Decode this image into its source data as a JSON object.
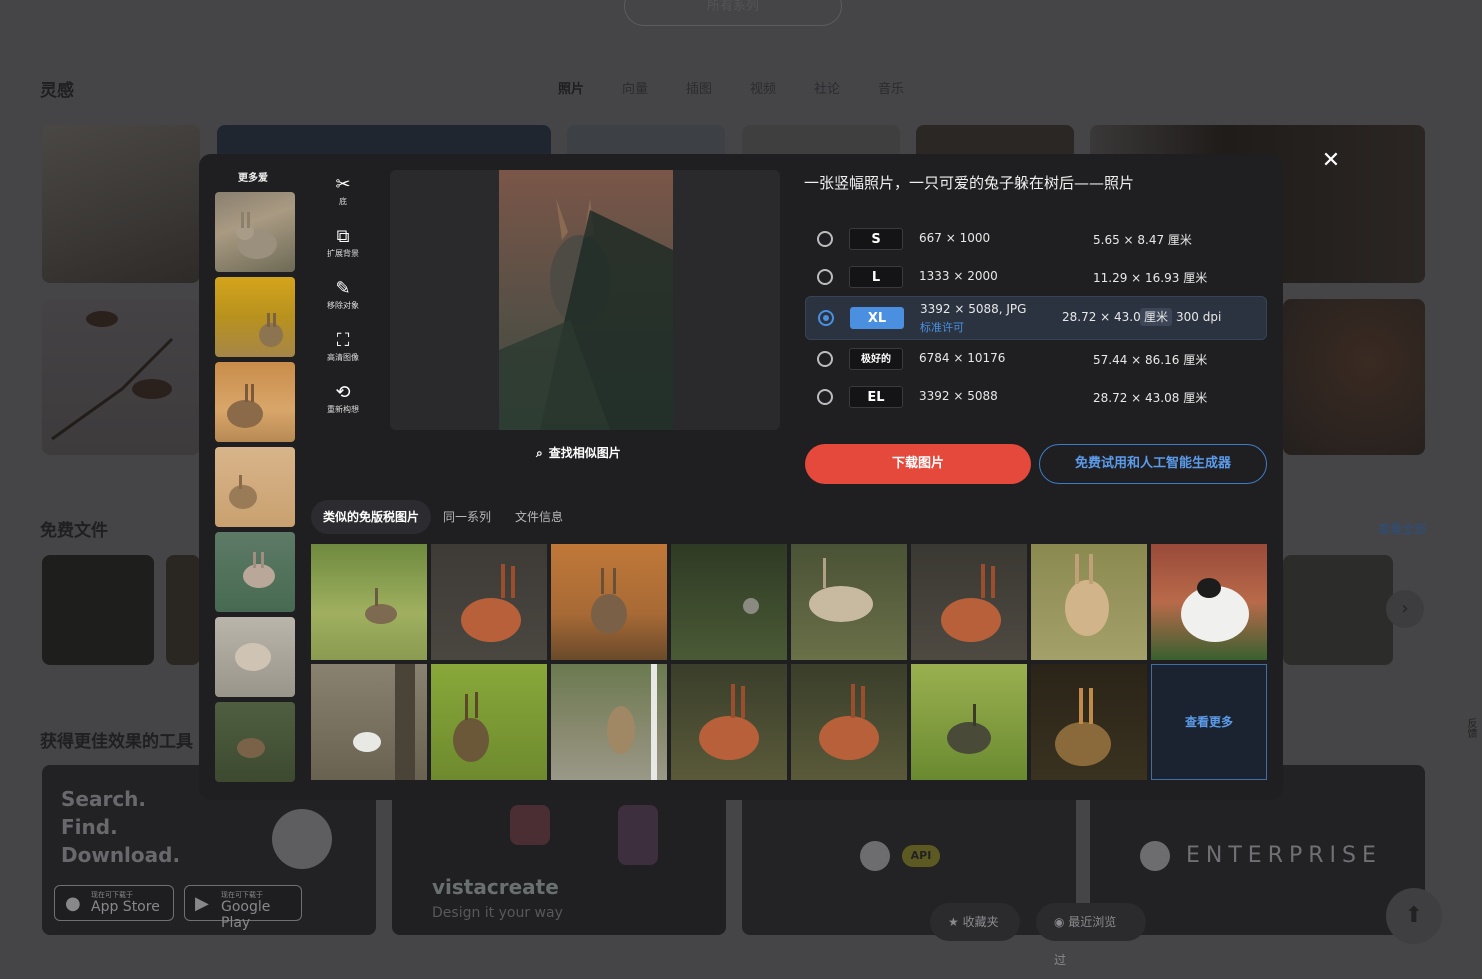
{
  "background": {
    "series_pill": "所有系列",
    "inspiration_title": "灵感",
    "tabs": [
      "照片",
      "向量",
      "插图",
      "视频",
      "社论",
      "音乐"
    ],
    "free_files_title": "免费文件",
    "see_all": "查看全部",
    "tools_title": "获得更佳效果的工具",
    "promo": {
      "line1": "Search.",
      "line2": "Find.",
      "line3": "Download.",
      "appstore_small": "现在可下载于",
      "appstore_big": "App Store",
      "googleplay_small": "现在可下载于",
      "googleplay_big": "Google Play",
      "vista_brand": "vistacreate",
      "vista_tagline": "Design it your way",
      "api_label": "API",
      "enterprise": "ENTERPRISE"
    },
    "favorites_label": "收藏夹",
    "recent_label": "最近浏览过",
    "feedback_label": "反馈"
  },
  "modal": {
    "more_like_label": "更多爱",
    "tools": [
      {
        "label": "底",
        "icon": "scissors-icon"
      },
      {
        "label": "扩展背景",
        "icon": "expand-background-icon"
      },
      {
        "label": "移除对象",
        "icon": "remove-object-icon"
      },
      {
        "label": "高清图像",
        "icon": "upscale-icon"
      },
      {
        "label": "重新构想",
        "icon": "reimagine-icon"
      }
    ],
    "find_similar": "查找相似图片",
    "title": "一张竖幅照片，一只可爱的兔子躲在树后——照片",
    "sizes": [
      {
        "badge": "S",
        "px": "667 × 1000",
        "cm": "5.65 × 8.47 厘米",
        "selected": false
      },
      {
        "badge": "L",
        "px": "1333 × 2000",
        "cm": "11.29 × 16.93 厘米",
        "selected": false
      },
      {
        "badge": "XL",
        "px": "3392 × 5088, JPG",
        "license": "标准许可",
        "cm": "28.72 × 43.08",
        "unit": "厘米",
        "dpi": "300 dpi",
        "selected": true
      },
      {
        "badge": "极好的",
        "px": "6784 × 10176",
        "cm": "57.44 × 86.16 厘米",
        "selected": false
      },
      {
        "badge": "EL",
        "px": "3392 × 5088",
        "cm": "28.72 × 43.08 厘米",
        "selected": false
      }
    ],
    "download_button": "下载图片",
    "ai_button": "免费试用和人工智能生成器",
    "subtabs": [
      "类似的免版税图片",
      "同一系列",
      "文件信息"
    ],
    "see_more": "查看更多"
  },
  "colors": {
    "download": "#e5493b",
    "accent_blue": "#4a8fe0",
    "modal_bg": "#1f1f22"
  }
}
